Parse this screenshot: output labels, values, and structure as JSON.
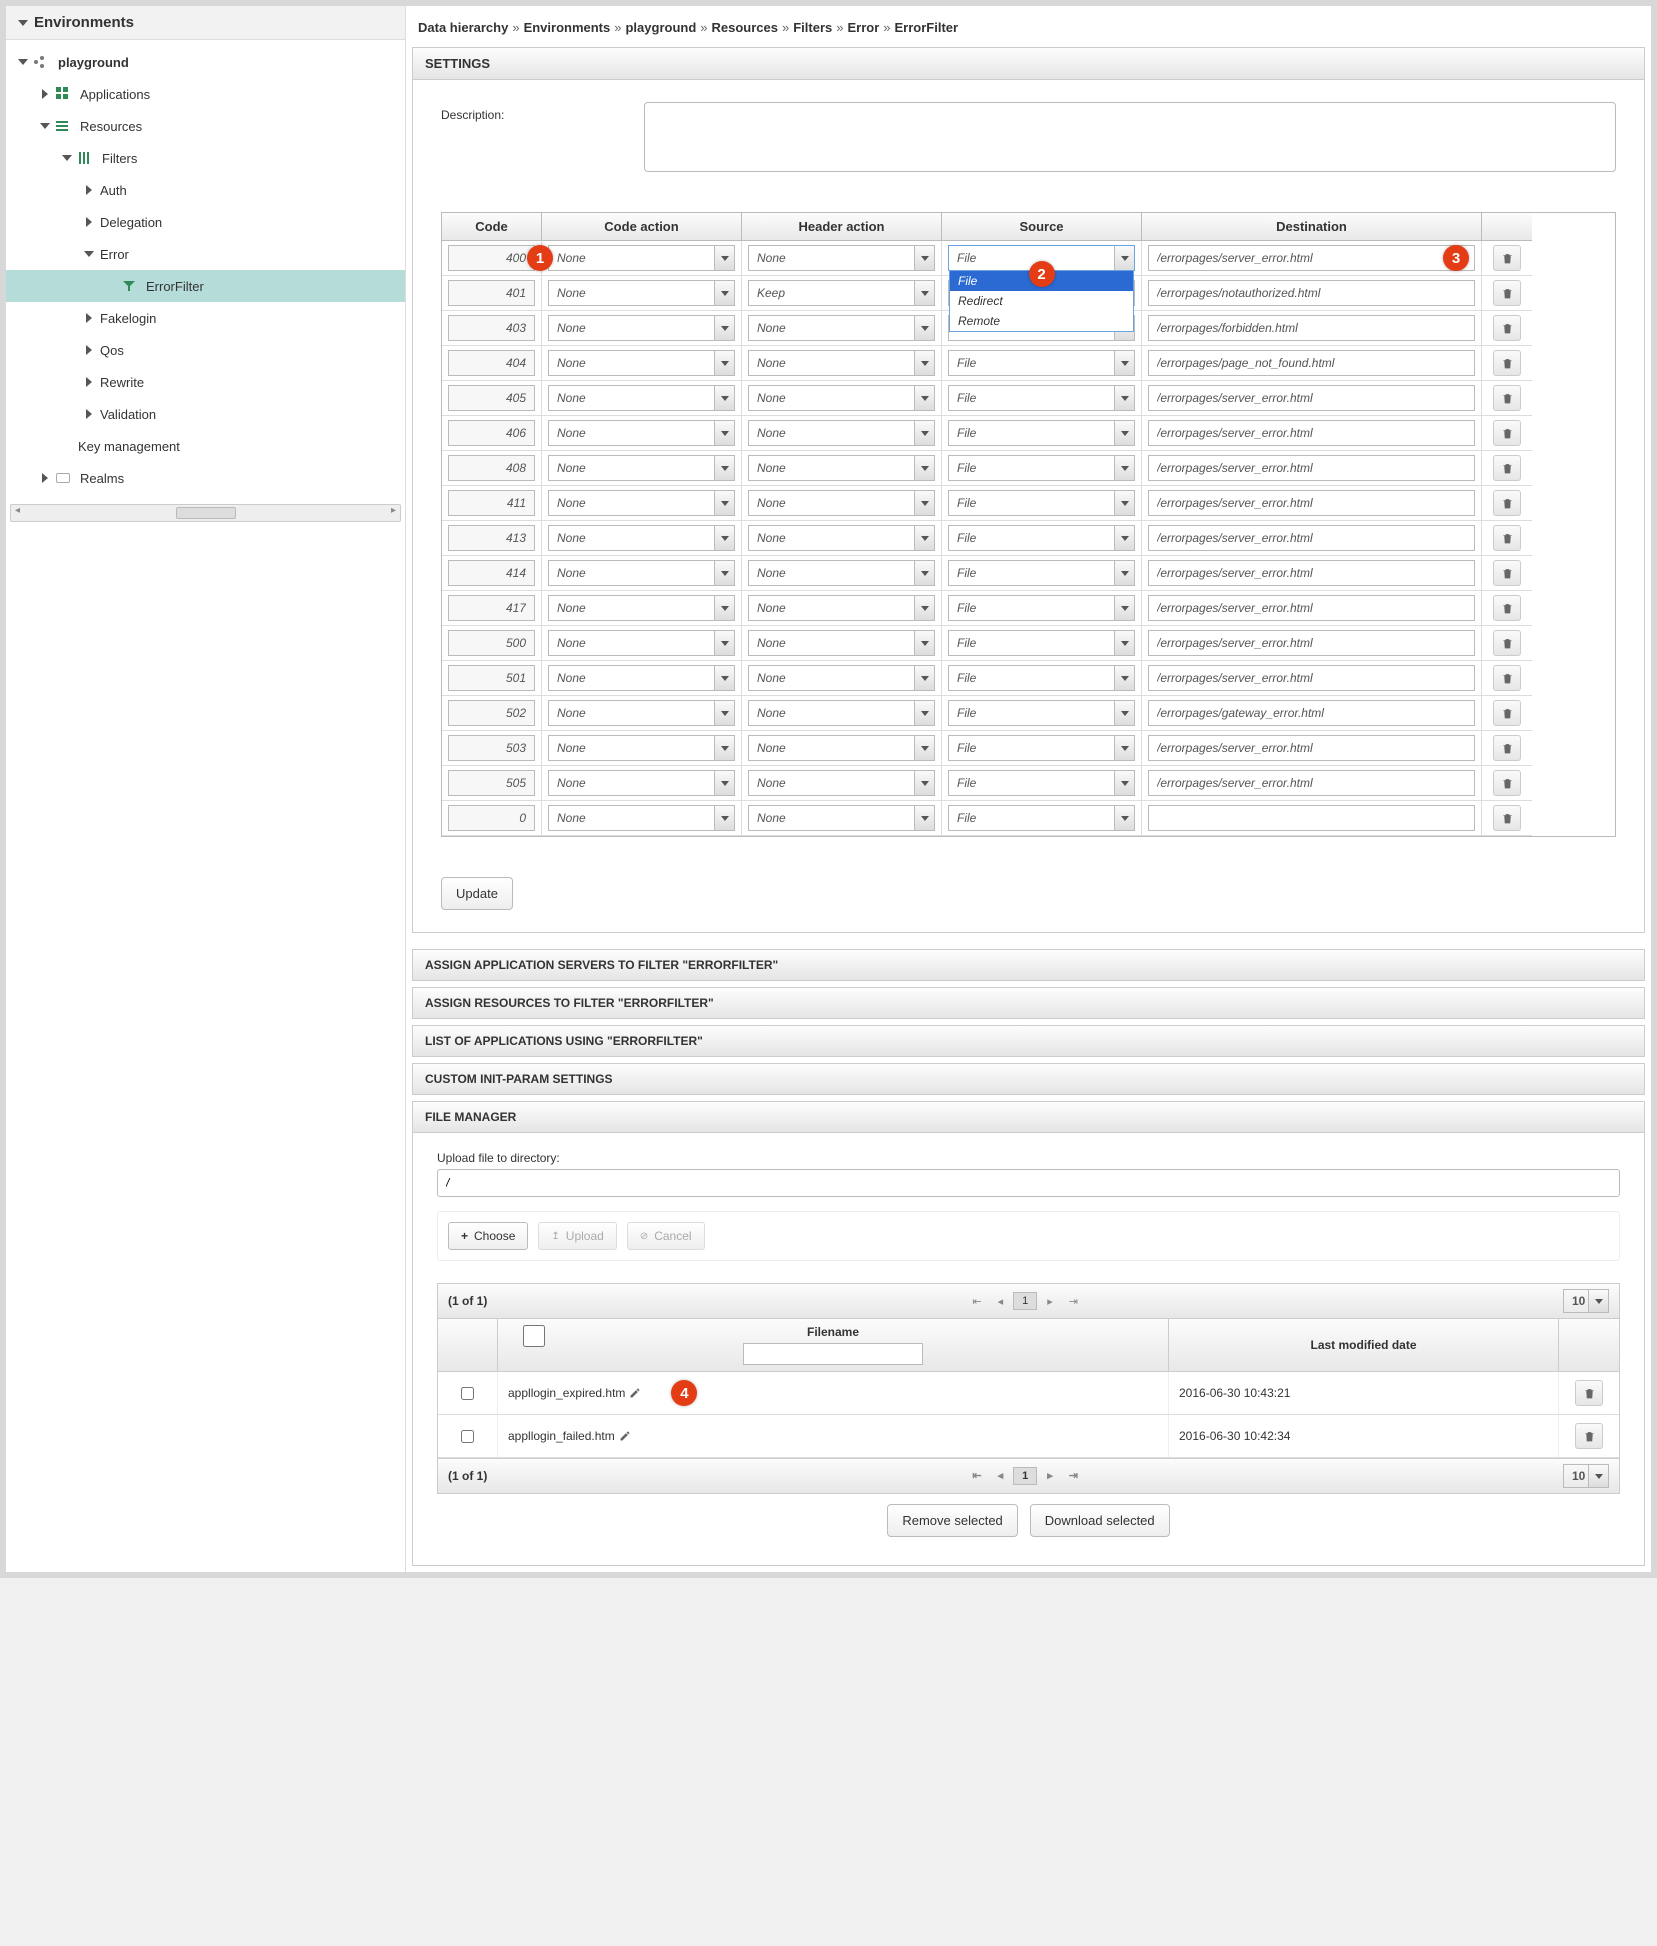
{
  "sidebar": {
    "title": "Environments",
    "items": [
      {
        "label": "playground",
        "depth": 0,
        "expanded": true,
        "icon": "cluster",
        "bold": true
      },
      {
        "label": "Applications",
        "depth": 1,
        "collapsed": true,
        "icon": "apps"
      },
      {
        "label": "Resources",
        "depth": 1,
        "expanded": true,
        "icon": "res"
      },
      {
        "label": "Filters",
        "depth": 2,
        "expanded": true,
        "icon": "filters"
      },
      {
        "label": "Auth",
        "depth": 3,
        "collapsed": true
      },
      {
        "label": "Delegation",
        "depth": 3,
        "collapsed": true
      },
      {
        "label": "Error",
        "depth": 3,
        "expanded": true
      },
      {
        "label": "ErrorFilter",
        "depth": 4,
        "selected": true,
        "icon": "funnel"
      },
      {
        "label": "Fakelogin",
        "depth": 3,
        "collapsed": true
      },
      {
        "label": "Qos",
        "depth": 3,
        "collapsed": true
      },
      {
        "label": "Rewrite",
        "depth": 3,
        "collapsed": true
      },
      {
        "label": "Validation",
        "depth": 3,
        "collapsed": true
      },
      {
        "label": "Key management",
        "depth": 2
      },
      {
        "label": "Realms",
        "depth": 1,
        "collapsed": true,
        "icon": "realms"
      }
    ]
  },
  "breadcrumb": [
    "Data hierarchy",
    "Environments",
    "playground",
    "Resources",
    "Filters",
    "Error",
    "ErrorFilter"
  ],
  "settings_title": "SETTINGS",
  "description_label": "Description:",
  "description_value": "",
  "grid_headers": {
    "code": "Code",
    "code_action": "Code action",
    "header_action": "Header action",
    "source": "Source",
    "destination": "Destination"
  },
  "source_dropdown": {
    "selected": "File",
    "options": [
      "File",
      "Redirect",
      "Remote"
    ]
  },
  "rows": [
    {
      "code": "400",
      "code_action": "None",
      "header_action": "None",
      "source": "File",
      "dest": "/errorpages/server_error.html",
      "open": true
    },
    {
      "code": "401",
      "code_action": "None",
      "header_action": "Keep",
      "source": "",
      "dest": "/errorpages/notauthorized.html"
    },
    {
      "code": "403",
      "code_action": "None",
      "header_action": "None",
      "source": "File",
      "dest": "/errorpages/forbidden.html"
    },
    {
      "code": "404",
      "code_action": "None",
      "header_action": "None",
      "source": "File",
      "dest": "/errorpages/page_not_found.html"
    },
    {
      "code": "405",
      "code_action": "None",
      "header_action": "None",
      "source": "File",
      "dest": "/errorpages/server_error.html"
    },
    {
      "code": "406",
      "code_action": "None",
      "header_action": "None",
      "source": "File",
      "dest": "/errorpages/server_error.html"
    },
    {
      "code": "408",
      "code_action": "None",
      "header_action": "None",
      "source": "File",
      "dest": "/errorpages/server_error.html"
    },
    {
      "code": "411",
      "code_action": "None",
      "header_action": "None",
      "source": "File",
      "dest": "/errorpages/server_error.html"
    },
    {
      "code": "413",
      "code_action": "None",
      "header_action": "None",
      "source": "File",
      "dest": "/errorpages/server_error.html"
    },
    {
      "code": "414",
      "code_action": "None",
      "header_action": "None",
      "source": "File",
      "dest": "/errorpages/server_error.html"
    },
    {
      "code": "417",
      "code_action": "None",
      "header_action": "None",
      "source": "File",
      "dest": "/errorpages/server_error.html"
    },
    {
      "code": "500",
      "code_action": "None",
      "header_action": "None",
      "source": "File",
      "dest": "/errorpages/server_error.html"
    },
    {
      "code": "501",
      "code_action": "None",
      "header_action": "None",
      "source": "File",
      "dest": "/errorpages/server_error.html"
    },
    {
      "code": "502",
      "code_action": "None",
      "header_action": "None",
      "source": "File",
      "dest": "/errorpages/gateway_error.html"
    },
    {
      "code": "503",
      "code_action": "None",
      "header_action": "None",
      "source": "File",
      "dest": "/errorpages/server_error.html"
    },
    {
      "code": "505",
      "code_action": "None",
      "header_action": "None",
      "source": "File",
      "dest": "/errorpages/server_error.html"
    },
    {
      "code": "0",
      "code_action": "None",
      "header_action": "None",
      "source": "File",
      "dest": ""
    }
  ],
  "update_label": "Update",
  "accordions": [
    "ASSIGN APPLICATION SERVERS TO FILTER \"ERRORFILTER\"",
    "ASSIGN RESOURCES TO FILTER \"ERRORFILTER\"",
    "LIST OF APPLICATIONS USING \"ERRORFILTER\"",
    "CUSTOM INIT-PARAM SETTINGS",
    "FILE MANAGER"
  ],
  "fm": {
    "upload_label": "Upload file to directory:",
    "path": "/",
    "choose": "Choose",
    "upload": "Upload",
    "cancel": "Cancel",
    "pager_text": "(1 of 1)",
    "page": "1",
    "page_size": "10",
    "col_filename": "Filename",
    "col_date": "Last modified date",
    "files": [
      {
        "name": "appllogin_expired.htm",
        "date": "2016-06-30 10:43:21"
      },
      {
        "name": "appllogin_failed.htm",
        "date": "2016-06-30 10:42:34"
      }
    ],
    "remove": "Remove selected",
    "download": "Download selected"
  },
  "badges": {
    "1": "1",
    "2": "2",
    "3": "3",
    "4": "4"
  }
}
